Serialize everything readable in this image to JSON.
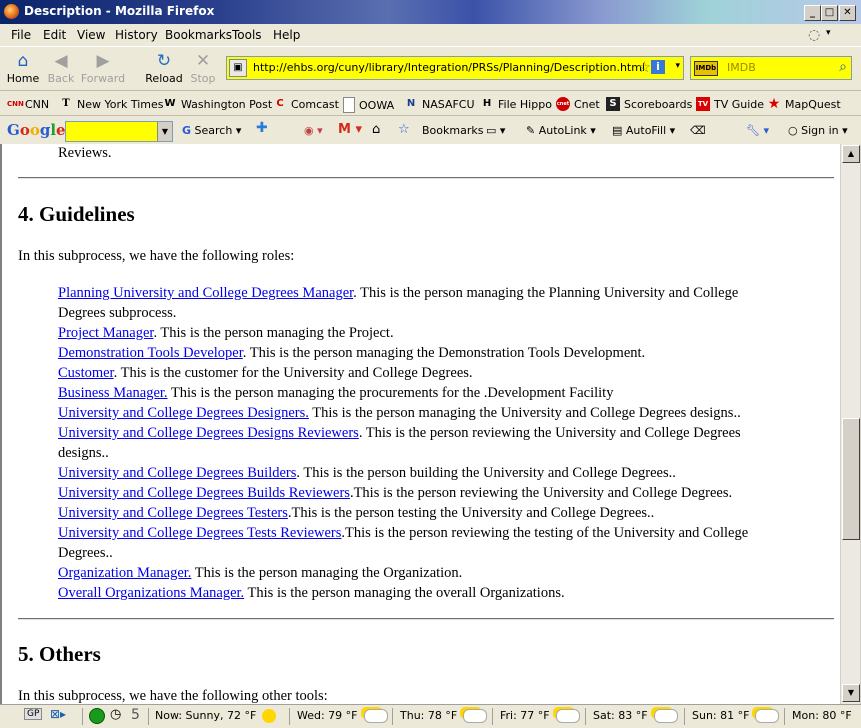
{
  "window": {
    "title": "Description - Mozilla Firefox"
  },
  "menu": [
    "File",
    "Edit",
    "View",
    "History",
    "Bookmarks",
    "Tools",
    "Help"
  ],
  "nav": {
    "home": "Home",
    "back": "Back",
    "forward": "Forward",
    "reload": "Reload",
    "stop": "Stop",
    "url": "http://ehbs.org/cuny/library/Integration/PRSs/Planning/Description.html",
    "search_placeholder": "IMDB",
    "search_engine": "IMDb"
  },
  "bookmarks": [
    "CNN",
    "New York Times",
    "Washington Post",
    "Comcast",
    "OOWA",
    "NASAFCU",
    "File Hippo",
    "Cnet",
    "Scoreboards",
    "TV Guide",
    "MapQuest"
  ],
  "bookmark_icons": [
    "CNN",
    "T",
    "W",
    "C",
    "",
    "N",
    "H",
    "cnet",
    "S",
    "TV",
    "★"
  ],
  "google": {
    "logo": "Google",
    "search": "Search",
    "bookmarks": "Bookmarks",
    "autolink": "AutoLink",
    "autofill": "AutoFill",
    "signin": "Sign in"
  },
  "content": {
    "top_fragment": "Reviews.",
    "section4_title": "4. Guidelines",
    "section4_intro": "In this subprocess, we have the following roles:",
    "roles": [
      {
        "link": "Planning University and College Degrees Manager",
        "text": ". This is the person managing the Planning University and College",
        "cont": "Degrees subprocess."
      },
      {
        "link": "Project Manager",
        "text": ". This is the person managing the Project."
      },
      {
        "link": "Demonstration Tools Developer",
        "text": ". This is the person managing the Demonstration Tools Development."
      },
      {
        "link": "Customer",
        "text": ". This is the customer for the University and College Degrees."
      },
      {
        "link": "Business Manager.",
        "text": " This is the person managing the procurements for the .Development Facility"
      },
      {
        "link": "University and College Degrees Designers.",
        "text": " This is the person managing the University and College Degrees designs.."
      },
      {
        "link": "University and College Degrees Designs Reviewers",
        "text": ". This is the person reviewing the University and College Degrees",
        "cont": "designs.."
      },
      {
        "link": "University and College Degrees Builders",
        "text": ". This is the person building the University and College Degrees.."
      },
      {
        "link": "University and College Degrees Builds Reviewers",
        "text": ".This is the person reviewing the University and College Degrees."
      },
      {
        "link": "University and College Degrees Testers",
        "text": ".This is the person testing the University and College Degrees.."
      },
      {
        "link": "University and College Degrees Tests Reviewers",
        "text": ".This is the person reviewing the testing of the University and College",
        "cont": "Degrees.."
      },
      {
        "link": "Organization Manager.",
        "text": " This is the person managing the Organization."
      },
      {
        "link": "Overall Organizations Manager.",
        "text": " This is the person managing the overall Organizations."
      }
    ],
    "section5_title": "5. Others",
    "section5_intro": "In this subprocess, we have the following other tools:"
  },
  "status": {
    "gp": "GP",
    "count": "5",
    "weather": [
      {
        "label": "Now: Sunny, 72 °F",
        "icon": "sun"
      },
      {
        "label": "Wed: 79 °F",
        "icon": "partly-cloudy"
      },
      {
        "label": "Thu: 78 °F",
        "icon": "partly-cloudy"
      },
      {
        "label": "Fri: 77 °F",
        "icon": "partly-cloudy"
      },
      {
        "label": "Sat: 83 °F",
        "icon": "partly-cloudy"
      },
      {
        "label": "Sun: 81 °F",
        "icon": "partly-cloudy"
      },
      {
        "label": "Mon: 80 °F",
        "icon": "partly-cloudy"
      }
    ]
  }
}
